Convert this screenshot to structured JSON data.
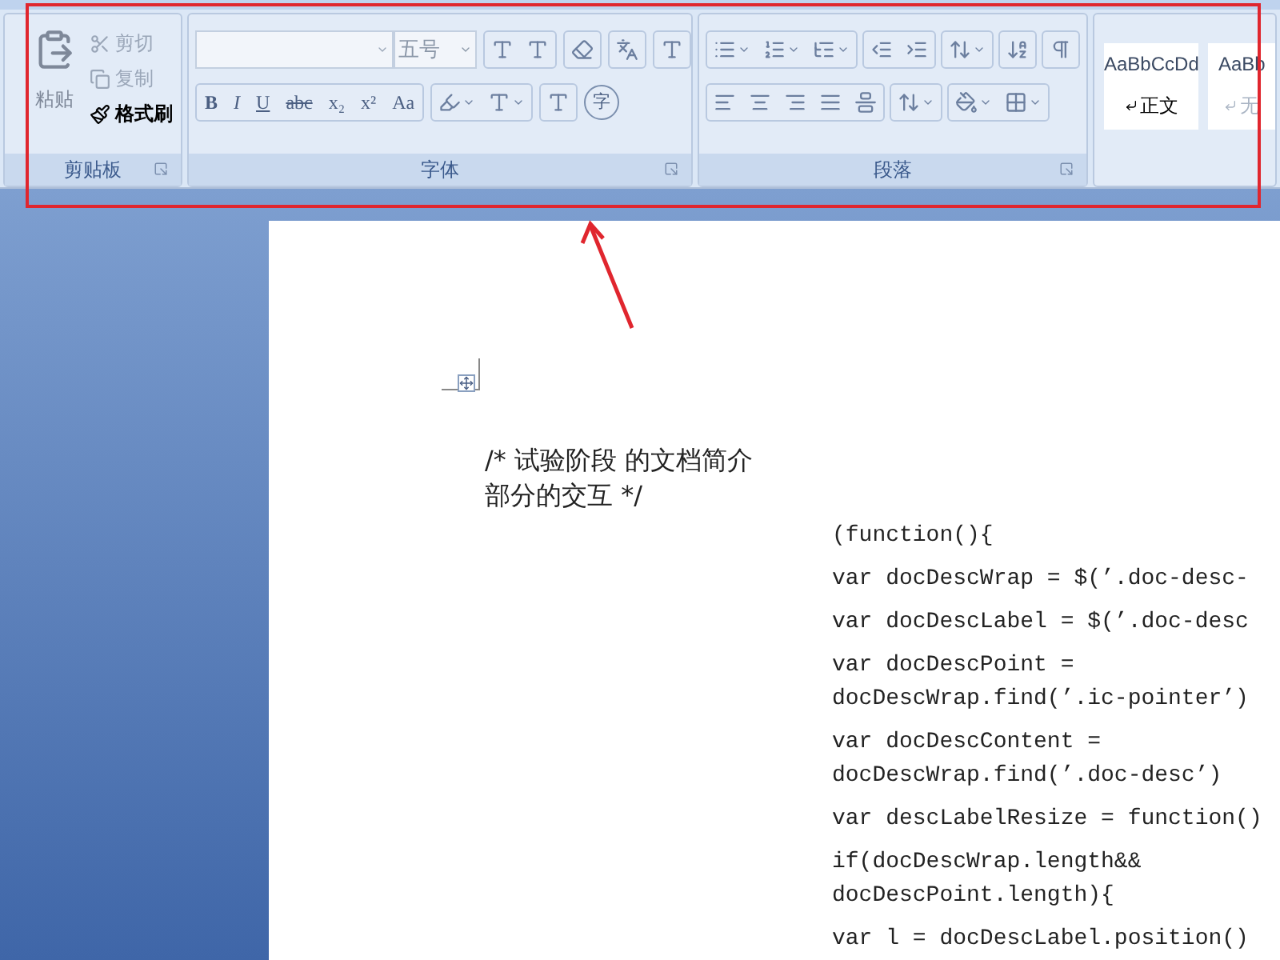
{
  "clipboard": {
    "label": "剪贴板",
    "paste": {
      "label": "粘贴",
      "disabled": true
    },
    "items": [
      {
        "kind": "cut",
        "label": "剪切",
        "disabled": true
      },
      {
        "kind": "copy",
        "label": "复制",
        "disabled": true
      },
      {
        "kind": "painter",
        "label": "格式刷",
        "disabled": false
      }
    ]
  },
  "font": {
    "label": "字体",
    "font_size": {
      "value": "五号"
    },
    "format_buttons": [
      {
        "kind": "bold",
        "text": "B"
      },
      {
        "kind": "italic",
        "text": "I"
      },
      {
        "kind": "underline",
        "text": "U"
      },
      {
        "kind": "strike",
        "text": "abc"
      },
      {
        "kind": "sub",
        "text": "x₂"
      },
      {
        "kind": "sup",
        "text": "x²"
      },
      {
        "kind": "case",
        "text": "Aa"
      }
    ],
    "enclose_text": "字"
  },
  "paragraph": {
    "label": "段落"
  },
  "styles": [
    {
      "sample": "AaBbCcDd",
      "name": "正文",
      "selected": true
    },
    {
      "sample": "AaBb",
      "name": "无",
      "selected": false
    }
  ],
  "document": {
    "comment_lines": [
      "/* 试验阶段 的文档简介",
      "部分的交互 */"
    ],
    "code_paragraphs": [
      [
        "(function(){"
      ],
      [
        "var docDescWrap = $(’.doc-desc-"
      ],
      [
        "var docDescLabel = $(’.doc-desc"
      ],
      [
        "var docDescPoint =",
        "docDescWrap.find(’.ic-pointer’)"
      ],
      [
        "var docDescContent =",
        "docDescWrap.find(’.doc-desc’)"
      ],
      [
        "var descLabelResize = function()"
      ],
      [
        "if(docDescWrap.length&&",
        "docDescPoint.length){"
      ],
      [
        "var l = docDescLabel.position()"
      ]
    ]
  }
}
